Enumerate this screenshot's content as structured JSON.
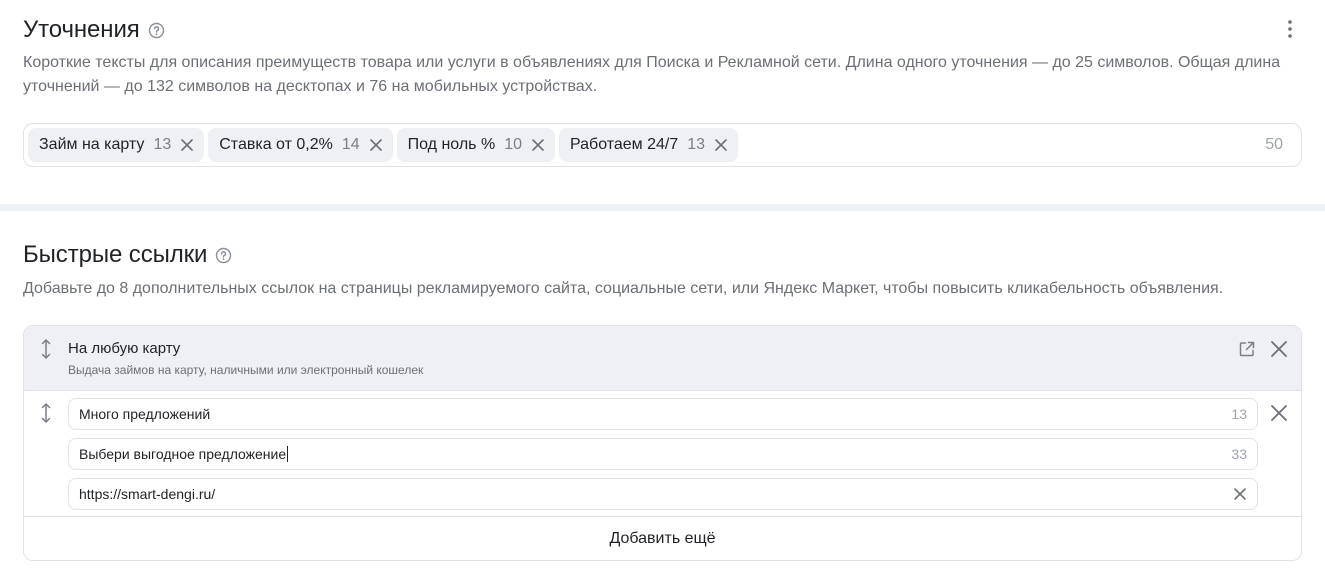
{
  "clarifications": {
    "title": "Уточнения",
    "description": "Короткие тексты для описания преимуществ товара или услуги в объявлениях для Поиска и Рекламной сети. Длина одного уточнения — до 25 символов. Общая длина уточнений — до 132 символов на десктопах и 76 на мобильных устройствах.",
    "chips": [
      {
        "label": "Займ на карту",
        "count": "13"
      },
      {
        "label": "Ставка от 0,2%",
        "count": "14"
      },
      {
        "label": "Под ноль %",
        "count": "10"
      },
      {
        "label": "Работаем 24/7",
        "count": "13"
      }
    ],
    "total": "50"
  },
  "sitelinks": {
    "title": "Быстрые ссылки",
    "description": "Добавьте до 8 дополнительных ссылок на страницы рекламируемого сайта, социальные сети, или Яндекс Маркет, чтобы повысить кликабельность объявления.",
    "collapsed": {
      "title": "На любую карту",
      "subtitle": "Выдача займов на карту, наличными или электронный кошелек"
    },
    "expanded": {
      "title_value": "Много предложений",
      "title_count": "13",
      "desc_value": "Выбери выгодное предложение",
      "desc_count": "33",
      "url_value": "https://smart-dengi.ru/"
    },
    "add_more": "Добавить ещё"
  },
  "colors": {
    "accent_bg": "#eef0f4",
    "border": "#dfe2e7",
    "muted_text": "#6b6f76"
  }
}
